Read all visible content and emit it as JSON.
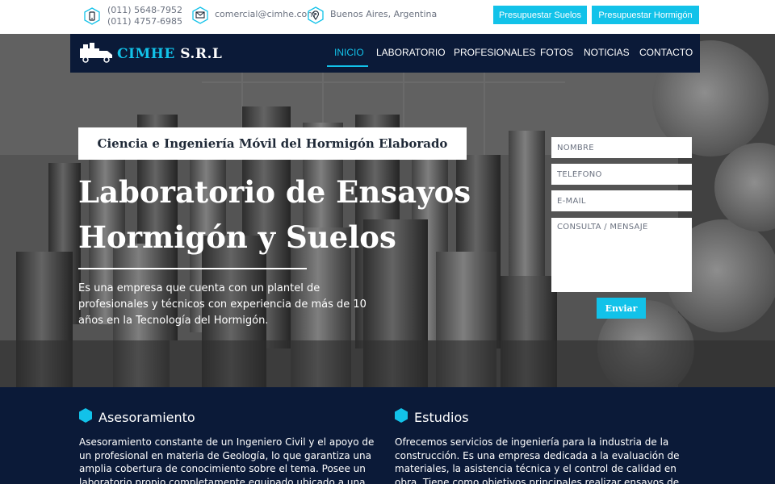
{
  "colors": {
    "accent": "#12c2e9",
    "navy": "#0b1a38"
  },
  "topbar": {
    "phones": [
      "(011) 5648-7952",
      "(011) 4757-6985"
    ],
    "phone_icon": "phone-icon",
    "email": "comercial@cimhe.com",
    "email_icon": "envelope-icon",
    "location": "Buenos Aires, Argentina",
    "location_icon": "map-pin-icon",
    "buttons": [
      "Presupuestar Suelos",
      "Presupuestar Hormigón"
    ]
  },
  "nav": {
    "logo": "CIMHE S.R.L",
    "logo_icon": "truck-icon",
    "items": [
      "INICIO",
      "LABORATORIO",
      "PROFESIONALES",
      "FOTOS",
      "NOTICIAS",
      "CONTACTO"
    ],
    "active": "INICIO"
  },
  "hero": {
    "subtitle": "Ciencia e Ingeniería Móvil del Hormigón Elaborado",
    "title_line1": "Laboratorio de Ensayos",
    "title_line2": "Hormigón y Suelos",
    "description": "Es una empresa que cuenta con un plantel de profesionales y técnicos con experiencia de más de 10 años en la Tecnología del Hormigón."
  },
  "form": {
    "name_placeholder": "NOMBRE",
    "phone_placeholder": "TELÉFONO",
    "email_placeholder": "E-MAIL",
    "message_placeholder": "CONSULTA / MENSAJE",
    "submit": "Enviar"
  },
  "services": [
    {
      "icon": "hexagon-icon",
      "title": "Asesoramiento",
      "text": "Asesoramiento constante de un Ingeniero Civil y el apoyo de un profesional en materia de Geología, lo que garantiza una amplia cobertura de conocimiento sobre el tema. Posee un laboratorio propio completamente equipado ubicado a una cuadra de Av. Beiró y Gral."
    },
    {
      "icon": "hexagon-icon",
      "title": "Estudios",
      "text": "Ofrecemos servicios de ingeniería para la industria de la construcción. Es una empresa dedicada a la evaluación de materiales, la asistencia técnica y el control de calidad en obra. Tiene como objetivos principales realizar ensayos de hormigón elaborado y"
    }
  ]
}
